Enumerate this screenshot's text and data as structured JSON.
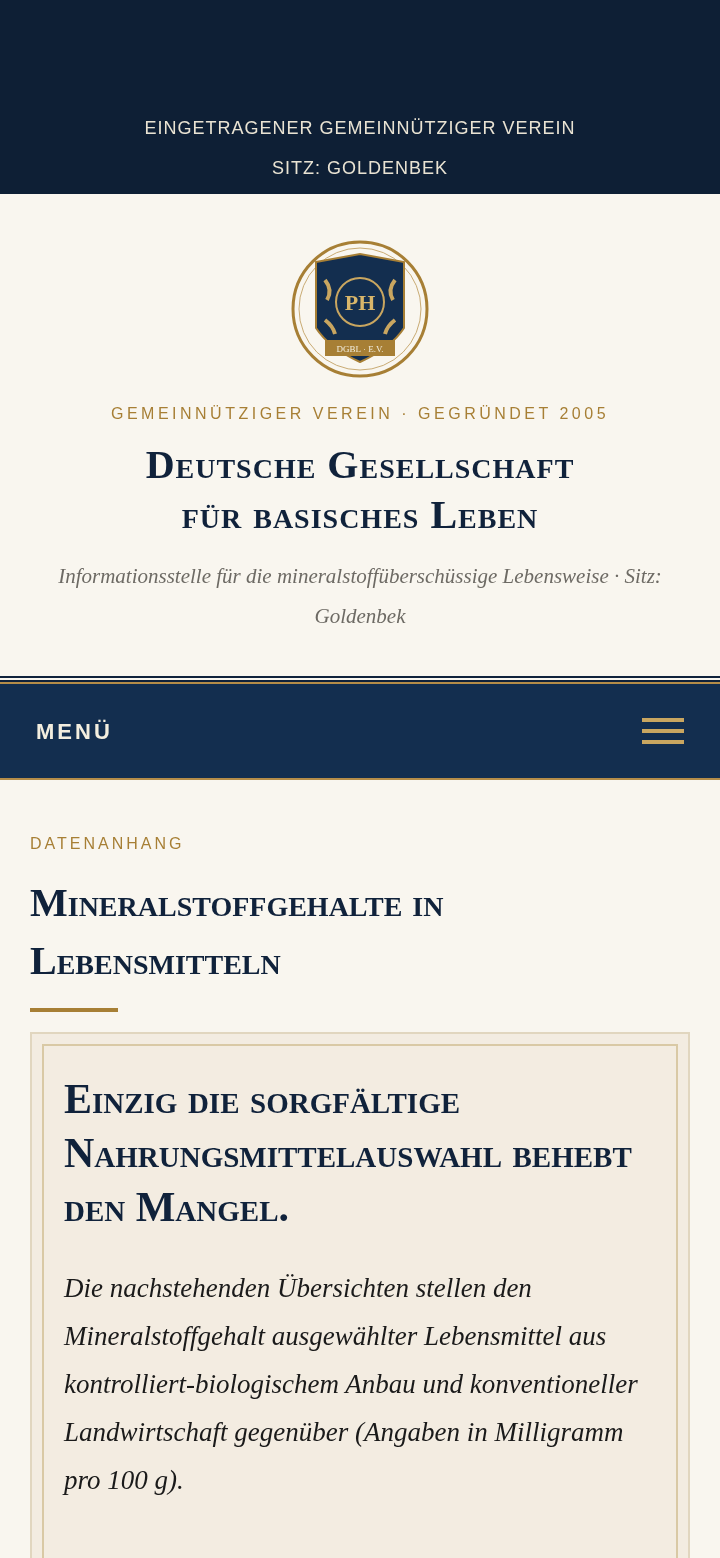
{
  "top_bar": {
    "lines": [
      "EINGETRAGENER GEMEINNÜTZIGER VEREIN",
      "SITZ: GOLDENBEK"
    ]
  },
  "logo": {
    "monogram": "PH",
    "banner": "DGBL · E.V."
  },
  "header": {
    "kicker": "GEMEINNÜTZIGER VEREIN · GEGRÜNDET 2005",
    "title_lines": [
      "Deutsche Gesellschaft",
      "für basisches Leben"
    ],
    "subtitle": "Informationsstelle für die mineralstoffüberschüssige Lebensweise · Sitz: Goldenbek"
  },
  "nav": {
    "label": "MENÜ"
  },
  "article": {
    "kicker": "DATENANHANG",
    "title": "Mineralstoffgehalte in Lebensmitteln",
    "box": {
      "heading": "Einzig die sorgfältige Nahrungsmittelauswahl behebt den Mangel.",
      "text": "Die nachstehenden Übersichten stellen den Mineralstoffgehalt ausgewählter Lebensmittel aus kontrolliert-biologischem Anbau und konventioneller Landwirtschaft gegenüber (Angaben in Milligramm pro 100 g)."
    }
  }
}
